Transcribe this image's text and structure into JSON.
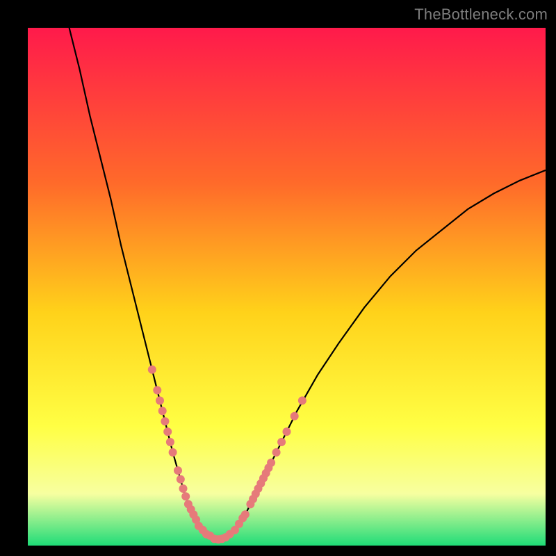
{
  "watermark": "TheBottleneck.com",
  "gradient": {
    "top_color": "#ff1a4b",
    "mid1_color": "#ff6a2a",
    "mid2_color": "#ffd21a",
    "mid3_color": "#ffff44",
    "band_color": "#f7ffa0",
    "bottom_color": "#1fdc78"
  },
  "curve_color": "#000000",
  "markers_color": "#e67a7a",
  "chart_data": {
    "type": "line",
    "title": "",
    "xlabel": "",
    "ylabel": "",
    "xlim": [
      0,
      100
    ],
    "ylim": [
      0,
      100
    ],
    "series": [
      {
        "name": "curve",
        "x": [
          8,
          10,
          12,
          14,
          16,
          18,
          20,
          22,
          24,
          26,
          28,
          30,
          31,
          32,
          33,
          34,
          35,
          36,
          37,
          38,
          40,
          42,
          44,
          46,
          48,
          50,
          52,
          56,
          60,
          65,
          70,
          75,
          80,
          85,
          90,
          95,
          100
        ],
        "y": [
          100,
          92,
          83,
          75,
          67,
          58,
          50,
          42,
          34,
          26,
          18,
          11,
          8,
          6,
          4,
          2.5,
          1.8,
          1.3,
          1.2,
          1.5,
          3,
          6,
          10,
          14,
          18,
          22,
          26,
          33,
          39,
          46,
          52,
          57,
          61,
          65,
          68,
          70.5,
          72.5
        ]
      }
    ],
    "grid": false,
    "legend": false,
    "markers_left": [
      {
        "x": 24.0,
        "y": 34.0
      },
      {
        "x": 25.0,
        "y": 30.0
      },
      {
        "x": 25.5,
        "y": 28.0
      },
      {
        "x": 26.0,
        "y": 26.0
      },
      {
        "x": 26.5,
        "y": 24.0
      },
      {
        "x": 27.0,
        "y": 22.0
      },
      {
        "x": 27.5,
        "y": 20.0
      },
      {
        "x": 28.0,
        "y": 18.0
      },
      {
        "x": 29.0,
        "y": 14.5
      },
      {
        "x": 29.5,
        "y": 12.8
      },
      {
        "x": 30.0,
        "y": 11.0
      },
      {
        "x": 30.5,
        "y": 9.5
      },
      {
        "x": 31.0,
        "y": 8.0
      },
      {
        "x": 31.5,
        "y": 7.0
      },
      {
        "x": 32.0,
        "y": 6.0
      },
      {
        "x": 32.5,
        "y": 5.0
      }
    ],
    "markers_bottom": [
      {
        "x": 33.0,
        "y": 3.8
      },
      {
        "x": 33.8,
        "y": 3.0
      },
      {
        "x": 34.5,
        "y": 2.2
      },
      {
        "x": 35.2,
        "y": 1.9
      },
      {
        "x": 36.0,
        "y": 1.3
      },
      {
        "x": 36.8,
        "y": 1.2
      },
      {
        "x": 37.5,
        "y": 1.3
      },
      {
        "x": 38.2,
        "y": 1.6
      },
      {
        "x": 39.0,
        "y": 2.2
      },
      {
        "x": 40.0,
        "y": 3.0
      }
    ],
    "markers_right": [
      {
        "x": 40.8,
        "y": 4.2
      },
      {
        "x": 41.5,
        "y": 5.3
      },
      {
        "x": 42.0,
        "y": 6.0
      },
      {
        "x": 43.0,
        "y": 8.0
      },
      {
        "x": 43.5,
        "y": 9.0
      },
      {
        "x": 44.0,
        "y": 10.0
      },
      {
        "x": 44.5,
        "y": 11.0
      },
      {
        "x": 45.0,
        "y": 12.0
      },
      {
        "x": 45.5,
        "y": 13.0
      },
      {
        "x": 46.0,
        "y": 14.0
      },
      {
        "x": 46.5,
        "y": 15.0
      },
      {
        "x": 47.0,
        "y": 16.0
      },
      {
        "x": 48.0,
        "y": 18.0
      },
      {
        "x": 49.0,
        "y": 20.0
      },
      {
        "x": 50.0,
        "y": 22.0
      },
      {
        "x": 51.5,
        "y": 25.0
      },
      {
        "x": 53.0,
        "y": 28.0
      }
    ]
  }
}
